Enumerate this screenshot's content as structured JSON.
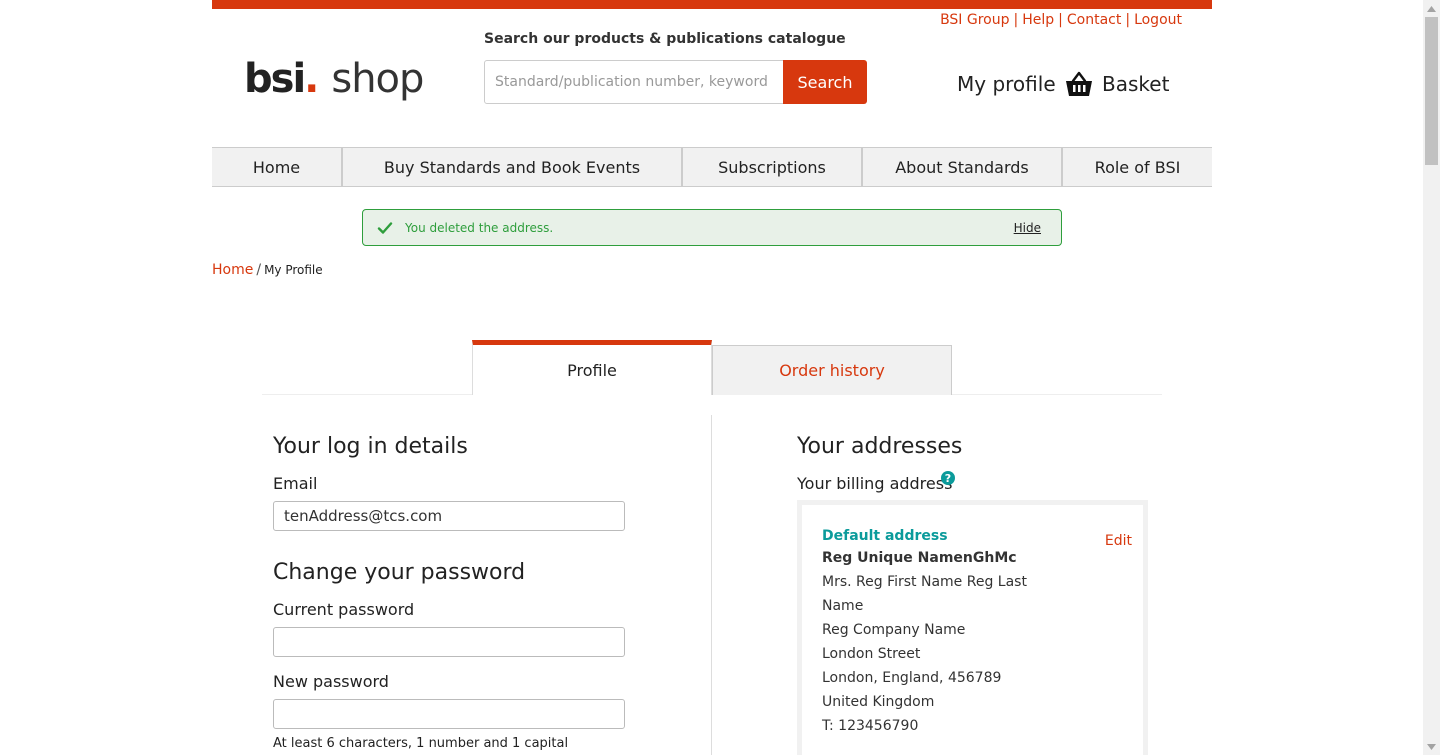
{
  "header": {
    "util_links": [
      "BSI Group",
      "Help",
      "Contact",
      "Logout"
    ],
    "logo": {
      "brand": "bsi",
      "dot": ".",
      "word": "shop"
    },
    "search": {
      "label": "Search our products & publications catalogue",
      "placeholder": "Standard/publication number, keyword",
      "button": "Search"
    },
    "my_profile": "My profile",
    "basket": "Basket"
  },
  "nav": [
    "Home",
    "Buy Standards and Book Events",
    "Subscriptions",
    "About Standards",
    "Role of BSI"
  ],
  "alert": {
    "message": "You deleted the address.",
    "hide": "Hide"
  },
  "breadcrumb": {
    "home": "Home",
    "separator": "/",
    "current": "My Profile"
  },
  "tabs": {
    "profile": "Profile",
    "orders": "Order history"
  },
  "login": {
    "title": "Your log in details",
    "email_label": "Email",
    "email_value": "tenAddress@tcs.com"
  },
  "password": {
    "title": "Change your password",
    "current_label": "Current password",
    "new_label": "New password",
    "hint": "At least 6 characters, 1 number and 1 capital"
  },
  "addresses": {
    "title": "Your addresses",
    "billing_label": "Your billing address",
    "help_glyph": "?",
    "card": {
      "default": "Default address",
      "edit": "Edit",
      "name": "Reg Unique NamenGhMc",
      "lines": [
        "Mrs. Reg First Name Reg Last",
        "Name",
        "Reg Company Name",
        "London Street",
        "London, England, 456789",
        "United Kingdom",
        "T: 123456790"
      ]
    }
  },
  "colors": {
    "brand": "#d7380e",
    "success": "#2e9e3c",
    "teal": "#0b9b9b"
  }
}
